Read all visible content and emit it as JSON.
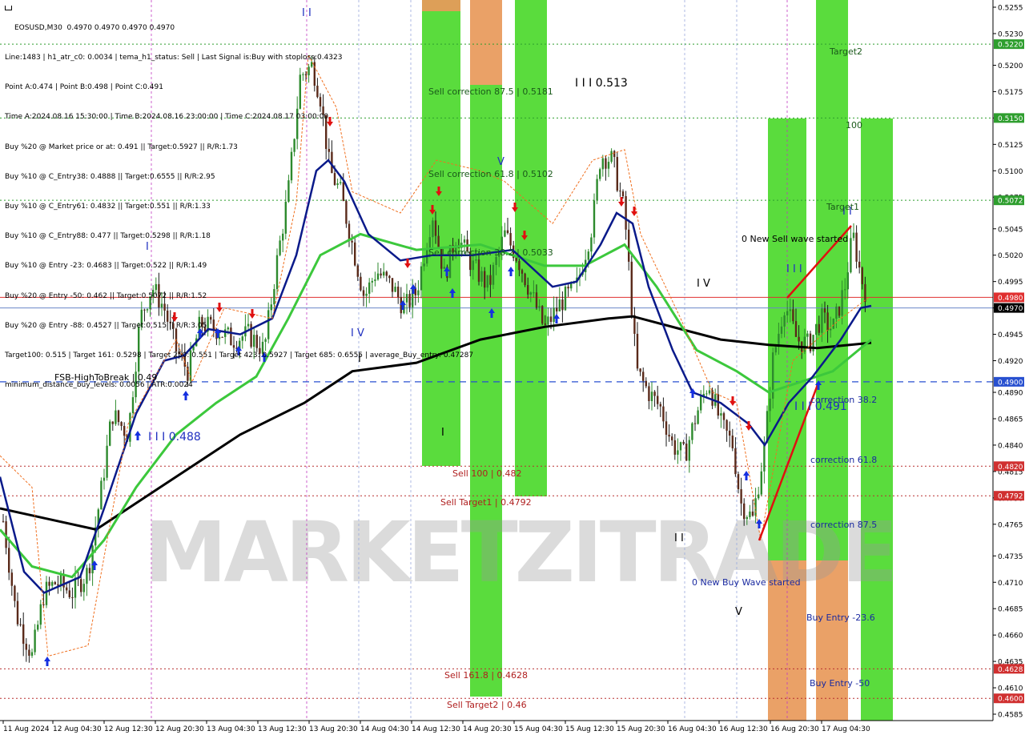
{
  "chart_data": {
    "type": "candlestick",
    "symbol": "EOSUSD",
    "timeframe": "M30",
    "title": "EOSUSD,M30  0.4970 0.4970 0.4970 0.4970",
    "info_lines": [
      "Line:1483 | h1_atr_c0: 0.0034 | tema_h1_status: Sell | Last Signal is:Buy with stoploss:0.4323",
      "Point A:0.474 | Point B:0.498 | Point C:0.491",
      "Time A:2024.08.16 15:30:00 | Time B:2024.08.16 23:00:00 | Time C:2024.08.17 03:00:00",
      "Buy %20 @ Market price or at: 0.491 || Target:0.5927 || R/R:1.73",
      "Buy %10 @ C_Entry38: 0.4888 || Target:0.6555 || R/R:2.95",
      "Buy %10 @ C_Entry61: 0.4832 || Target:0.551 || R/R:1.33",
      "Buy %10 @ C_Entry88: 0.477 || Target:0.5298 || R/R:1.18",
      "Buy %10 @ Entry -23: 0.4683 || Target:0.522 || R/R:1.49",
      "Buy %20 @ Entry -50: 0.462 || Target:0.5072 || R/R:1.52",
      "Buy %20 @ Entry -88: 0.4527 || Target:0.515 || R/R:3.05",
      "Target100: 0.515 | Target 161: 0.5298 | Target 250: 0.551 | Target 423: 0.5927 | Target 685: 0.6555 | average_Buy_entry: 0.47287",
      "minimum_distance_buy_levels: 0.0056 | ATR:0.0024"
    ],
    "watermark": "MARKETZITRADE",
    "y_axis": {
      "min": 0.4585,
      "max": 0.5255,
      "ticks": [
        "0.5255",
        "0.5230",
        "0.5200",
        "0.5175",
        "0.5150",
        "0.5125",
        "0.5100",
        "0.5075",
        "0.5045",
        "0.5020",
        "0.4995",
        "0.4970",
        "0.4945",
        "0.4920",
        "0.4890",
        "0.4865",
        "0.4840",
        "0.4815",
        "0.4790",
        "0.4765",
        "0.4735",
        "0.4710",
        "0.4685",
        "0.4660",
        "0.4635",
        "0.4610",
        "0.4585"
      ]
    },
    "x_axis": {
      "labels": [
        "11 Aug 2024",
        "12 Aug 04:30",
        "12 Aug 12:30",
        "12 Aug 20:30",
        "13 Aug 04:30",
        "13 Aug 12:30",
        "13 Aug 20:30",
        "14 Aug 04:30",
        "14 Aug 12:30",
        "14 Aug 20:30",
        "15 Aug 04:30",
        "15 Aug 12:30",
        "15 Aug 20:30",
        "16 Aug 04:30",
        "16 Aug 12:30",
        "16 Aug 20:30",
        "17 Aug 04:30"
      ]
    },
    "price_tags": [
      {
        "value": "0.5220",
        "color": "#2e9e2e"
      },
      {
        "value": "0.5150",
        "color": "#2e9e2e"
      },
      {
        "value": "0.5072",
        "color": "#2e9e2e"
      },
      {
        "value": "0.4980",
        "color": "#e03030"
      },
      {
        "value": "0.4970",
        "color": "#000000"
      },
      {
        "value": "0.4900",
        "color": "#2850d0"
      },
      {
        "value": "0.4820",
        "color": "#d03030"
      },
      {
        "value": "0.4792",
        "color": "#d03030"
      },
      {
        "value": "0.4628",
        "color": "#d03030"
      },
      {
        "value": "0.4600",
        "color": "#d03030"
      }
    ],
    "levels": [
      {
        "price": 0.522,
        "color": "#2e9e2e",
        "style": "dotted"
      },
      {
        "price": 0.515,
        "color": "#2e9e2e",
        "style": "dotted"
      },
      {
        "price": 0.5072,
        "color": "#2e9e2e",
        "style": "dotted"
      },
      {
        "price": 0.498,
        "color": "#e03030",
        "style": "solid"
      },
      {
        "price": 0.497,
        "color": "#6a86c8",
        "style": "solid"
      },
      {
        "price": 0.49,
        "color": "#2850d0",
        "style": "dashed"
      },
      {
        "price": 0.482,
        "color": "#b83030",
        "style": "dotted"
      },
      {
        "price": 0.4792,
        "color": "#b83030",
        "style": "dotted"
      },
      {
        "price": 0.4628,
        "color": "#b83030",
        "style": "dotted"
      },
      {
        "price": 0.46,
        "color": "#b83030",
        "style": "dotted"
      }
    ],
    "annotations": [
      {
        "text": "Sell correction 87.5 | 0.5181",
        "color": "#1a5a1a"
      },
      {
        "text": "Sell correction 61.8 | 0.5102",
        "color": "#1a5a1a"
      },
      {
        "text": "Sell correction 38.2 | 0.5033",
        "color": "#1a5a1a"
      },
      {
        "text": "Sell 100 | 0.482",
        "color": "#b02020"
      },
      {
        "text": "Sell Target1 | 0.4792",
        "color": "#b02020"
      },
      {
        "text": "Sell 161.8 | 0.4628",
        "color": "#b02020"
      },
      {
        "text": "Sell Target2 | 0.46",
        "color": "#b02020"
      },
      {
        "text": "I I I 0.513",
        "color": "#000000"
      },
      {
        "text": "I I I 0.488",
        "color": "#2030c0"
      },
      {
        "text": "I I I 0.491",
        "color": "#2030c0"
      },
      {
        "text": "I V",
        "color": "#2030c0"
      },
      {
        "text": "I V",
        "color": "#000000"
      },
      {
        "text": "I",
        "color": "#2030c0"
      },
      {
        "text": "I",
        "color": "#000000"
      },
      {
        "text": "I",
        "color": "#000000"
      },
      {
        "text": "I I",
        "color": "#2030c0"
      },
      {
        "text": "I I",
        "color": "#000000"
      },
      {
        "text": "I I",
        "color": "#2030c0"
      },
      {
        "text": "I I I",
        "color": "#2030c0"
      },
      {
        "text": "V",
        "color": "#2030c0"
      },
      {
        "text": "V",
        "color": "#000000"
      },
      {
        "text": "FSB-HighToBreak | 0.49",
        "color": "#000000"
      },
      {
        "text": "0 New Sell wave started",
        "color": "#000000"
      },
      {
        "text": "0 New Buy Wave started",
        "color": "#1a2aa0"
      },
      {
        "text": "Target2",
        "color": "#1a5a1a"
      },
      {
        "text": "Target1",
        "color": "#1a5a1a"
      },
      {
        "text": "100",
        "color": "#1a5a1a"
      },
      {
        "text": "correction 38.2",
        "color": "#1a2aa0"
      },
      {
        "text": "correction 61.8",
        "color": "#1a2aa0"
      },
      {
        "text": "correction 87.5",
        "color": "#1a2aa0"
      },
      {
        "text": "Buy Entry -23.6",
        "color": "#1a2aa0"
      },
      {
        "text": "Buy Entry -50",
        "color": "#1a2aa0"
      }
    ],
    "series": [
      {
        "name": "tema",
        "color": "#0a1a8a"
      },
      {
        "name": "ma_fast",
        "color": "#3cc83c"
      },
      {
        "name": "ma_slow",
        "color": "#000000"
      },
      {
        "name": "channel",
        "color": "#f07020"
      }
    ]
  }
}
